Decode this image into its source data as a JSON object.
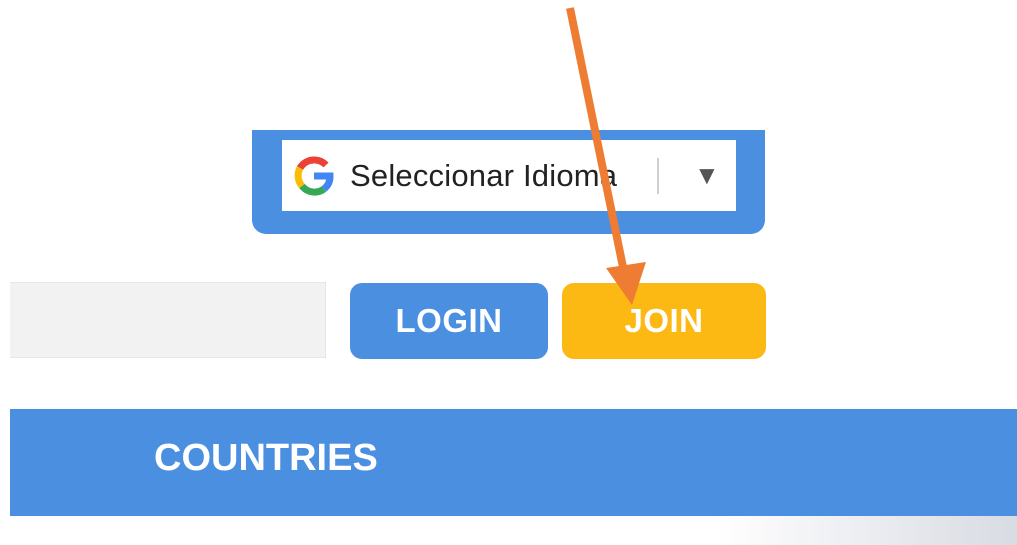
{
  "translate": {
    "label": "Seleccionar Idioma",
    "caret": "▼"
  },
  "buttons": {
    "login": "LOGIN",
    "join": "JOIN"
  },
  "nav": {
    "items": [
      {
        "label": "COUNTRIES"
      }
    ]
  },
  "colors": {
    "primary_blue": "#4a8fe0",
    "join_yellow": "#fdb913",
    "annotation_orange": "#ee7d33"
  },
  "icons": {
    "language": "google-g-icon",
    "caret": "chevron-down-icon",
    "annotation": "arrow-annotation-icon"
  }
}
